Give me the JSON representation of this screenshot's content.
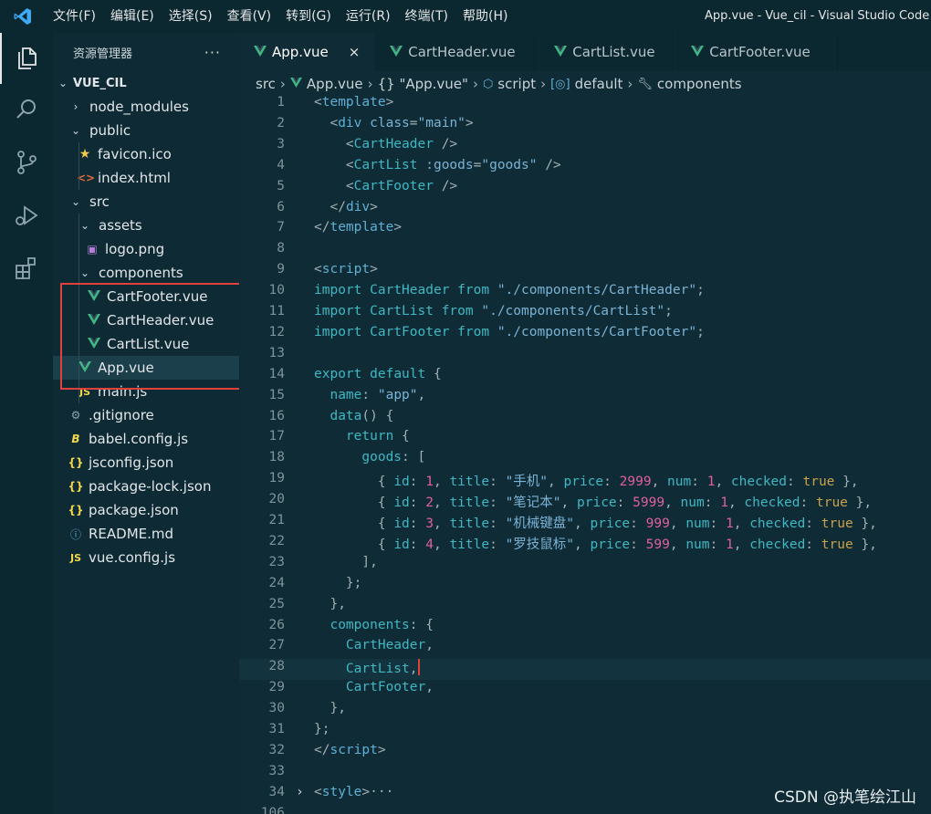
{
  "window": {
    "title": "App.vue - Vue_cil - Visual Studio Code",
    "menu": [
      "文件(F)",
      "编辑(E)",
      "选择(S)",
      "查看(V)",
      "转到(G)",
      "运行(R)",
      "终端(T)",
      "帮助(H)"
    ]
  },
  "activity": [
    "explorer-icon",
    "search-icon",
    "source-control-icon",
    "run-debug-icon",
    "extensions-icon"
  ],
  "sidebar": {
    "title": "资源管理器",
    "more": "···",
    "root": "VUE_CIL",
    "items": [
      {
        "label": "node_modules",
        "icon": "chevron-right",
        "depth": 1
      },
      {
        "label": "public",
        "icon": "chevron-down",
        "depth": 1
      },
      {
        "label": "favicon.ico",
        "icon": "star",
        "depth": 2
      },
      {
        "label": "index.html",
        "icon": "html",
        "depth": 2
      },
      {
        "label": "src",
        "icon": "chevron-down",
        "depth": 1
      },
      {
        "label": "assets",
        "icon": "chevron-down",
        "depth": 2
      },
      {
        "label": "logo.png",
        "icon": "image",
        "depth": 3
      },
      {
        "label": "components",
        "icon": "chevron-down",
        "depth": 2
      },
      {
        "label": "CartFooter.vue",
        "icon": "vue",
        "depth": 3
      },
      {
        "label": "CartHeader.vue",
        "icon": "vue",
        "depth": 3
      },
      {
        "label": "CartList.vue",
        "icon": "vue",
        "depth": 3
      },
      {
        "label": "App.vue",
        "icon": "vue",
        "depth": 2
      },
      {
        "label": "main.js",
        "icon": "js",
        "depth": 2
      },
      {
        "label": ".gitignore",
        "icon": "gear",
        "depth": 1
      },
      {
        "label": "babel.config.js",
        "icon": "babel",
        "depth": 1
      },
      {
        "label": "jsconfig.json",
        "icon": "json",
        "depth": 1
      },
      {
        "label": "package-lock.json",
        "icon": "json",
        "depth": 1
      },
      {
        "label": "package.json",
        "icon": "json",
        "depth": 1
      },
      {
        "label": "README.md",
        "icon": "info",
        "depth": 1
      },
      {
        "label": "vue.config.js",
        "icon": "js",
        "depth": 1
      }
    ]
  },
  "tabs": [
    {
      "label": "App.vue",
      "active": true,
      "close": "×"
    },
    {
      "label": "CartHeader.vue",
      "active": false
    },
    {
      "label": "CartList.vue",
      "active": false
    },
    {
      "label": "CartFooter.vue",
      "active": false
    }
  ],
  "breadcrumb": [
    "src",
    "App.vue",
    "{} \"App.vue\"",
    "script",
    "default",
    "components"
  ],
  "code": [
    {
      "n": "1",
      "html": "<span class='pm'>&lt;</span><span class='tg'>template</span><span class='pm'>&gt;</span>"
    },
    {
      "n": "2",
      "html": "  <span class='pm'>&lt;</span><span class='tg'>div</span> <span class='sr'>class</span><span class='pm'>=</span><span class='sr'>\"main\"</span><span class='pm'>&gt;</span>"
    },
    {
      "n": "3",
      "html": "    <span class='pm'>&lt;</span><span class='ky'>CartHeader</span> <span class='pm'>/&gt;</span>"
    },
    {
      "n": "4",
      "html": "    <span class='pm'>&lt;</span><span class='ky'>CartList</span> <span class='sr'>:goods</span><span class='pm'>=</span><span class='sr'>\"goods\"</span> <span class='pm'>/&gt;</span>"
    },
    {
      "n": "5",
      "html": "    <span class='pm'>&lt;</span><span class='ky'>CartFooter</span> <span class='pm'>/&gt;</span>"
    },
    {
      "n": "6",
      "html": "  <span class='pm'>&lt;/</span><span class='tg'>div</span><span class='pm'>&gt;</span>"
    },
    {
      "n": "7",
      "html": "<span class='pm'>&lt;/</span><span class='tg'>template</span><span class='pm'>&gt;</span>"
    },
    {
      "n": "8",
      "html": ""
    },
    {
      "n": "9",
      "html": "<span class='pm'>&lt;</span><span class='tg'>script</span><span class='pm'>&gt;</span>"
    },
    {
      "n": "10",
      "html": "<span class='ky'>import</span> <span class='ky'>CartHeader</span> <span class='ky'>from</span> <span class='sr'>\"./components/CartHeader\"</span><span class='pm'>;</span>"
    },
    {
      "n": "11",
      "html": "<span class='ky'>import</span> <span class='ky'>CartList</span> <span class='ky'>from</span> <span class='sr'>\"./components/CartList\"</span><span class='pm'>;</span>"
    },
    {
      "n": "12",
      "html": "<span class='ky'>import</span> <span class='ky'>CartFooter</span> <span class='ky'>from</span> <span class='sr'>\"./components/CartFooter\"</span><span class='pm'>;</span>"
    },
    {
      "n": "13",
      "html": ""
    },
    {
      "n": "14",
      "html": "<span class='ky'>export</span> <span class='ky'>default</span> <span class='pm'>{</span>"
    },
    {
      "n": "15",
      "html": "  <span class='ky'>name</span><span class='pm'>:</span> <span class='sr'>\"app\"</span><span class='pm'>,</span>"
    },
    {
      "n": "16",
      "html": "  <span class='ky'>data</span><span class='pm'>() {</span>"
    },
    {
      "n": "17",
      "html": "    <span class='ky'>return</span> <span class='pm'>{</span>"
    },
    {
      "n": "18",
      "html": "      <span class='ky'>goods</span><span class='pm'>: [</span>"
    },
    {
      "n": "19",
      "html": "        <span class='pm'>{</span> <span class='ky'>id</span><span class='pm'>:</span> <span class='pk'>1</span><span class='pm'>,</span> <span class='ky'>title</span><span class='pm'>:</span> <span class='sr'>\"手机\"</span><span class='pm'>,</span> <span class='ky'>price</span><span class='pm'>:</span> <span class='pk'>2999</span><span class='pm'>,</span> <span class='ky'>num</span><span class='pm'>:</span> <span class='pk'>1</span><span class='pm'>,</span> <span class='ky'>checked</span><span class='pm'>:</span> <span class='tr'>true</span> <span class='pm'>},</span>"
    },
    {
      "n": "20",
      "html": "        <span class='pm'>{</span> <span class='ky'>id</span><span class='pm'>:</span> <span class='pk'>2</span><span class='pm'>,</span> <span class='ky'>title</span><span class='pm'>:</span> <span class='sr'>\"笔记本\"</span><span class='pm'>,</span> <span class='ky'>price</span><span class='pm'>:</span> <span class='pk'>5999</span><span class='pm'>,</span> <span class='ky'>num</span><span class='pm'>:</span> <span class='pk'>1</span><span class='pm'>,</span> <span class='ky'>checked</span><span class='pm'>:</span> <span class='tr'>true</span> <span class='pm'>},</span>"
    },
    {
      "n": "21",
      "html": "        <span class='pm'>{</span> <span class='ky'>id</span><span class='pm'>:</span> <span class='pk'>3</span><span class='pm'>,</span> <span class='ky'>title</span><span class='pm'>:</span> <span class='sr'>\"机械键盘\"</span><span class='pm'>,</span> <span class='ky'>price</span><span class='pm'>:</span> <span class='pk'>999</span><span class='pm'>,</span> <span class='ky'>num</span><span class='pm'>:</span> <span class='pk'>1</span><span class='pm'>,</span> <span class='ky'>checked</span><span class='pm'>:</span> <span class='tr'>true</span> <span class='pm'>},</span>"
    },
    {
      "n": "22",
      "html": "        <span class='pm'>{</span> <span class='ky'>id</span><span class='pm'>:</span> <span class='pk'>4</span><span class='pm'>,</span> <span class='ky'>title</span><span class='pm'>:</span> <span class='sr'>\"罗技鼠标\"</span><span class='pm'>,</span> <span class='ky'>price</span><span class='pm'>:</span> <span class='pk'>599</span><span class='pm'>,</span> <span class='ky'>num</span><span class='pm'>:</span> <span class='pk'>1</span><span class='pm'>,</span> <span class='ky'>checked</span><span class='pm'>:</span> <span class='tr'>true</span> <span class='pm'>},</span>"
    },
    {
      "n": "23",
      "html": "      <span class='pm'>],</span>"
    },
    {
      "n": "24",
      "html": "    <span class='pm'>};</span>"
    },
    {
      "n": "25",
      "html": "  <span class='pm'>},</span>"
    },
    {
      "n": "26",
      "html": "  <span class='ky'>components</span><span class='pm'>: {</span>"
    },
    {
      "n": "27",
      "html": "    <span class='ky'>CartHeader</span><span class='pm'>,</span>"
    },
    {
      "n": "28",
      "html": "    <span class='ky'>CartList</span><span class='pm'>,</span><span class='caret'></span>"
    },
    {
      "n": "29",
      "html": "    <span class='ky'>CartFooter</span><span class='pm'>,</span>"
    },
    {
      "n": "30",
      "html": "  <span class='pm'>},</span>"
    },
    {
      "n": "31",
      "html": "<span class='pm'>};</span>"
    },
    {
      "n": "32",
      "html": "<span class='pm'>&lt;/</span><span class='tg'>script</span><span class='pm'>&gt;</span>"
    },
    {
      "n": "33",
      "html": ""
    },
    {
      "n": "34",
      "html": "<span class='pm'>&lt;</span><span class='tg'>style</span><span class='pm'>&gt;</span><span class='pm'>···</span>",
      "fold": "›"
    },
    {
      "n": "106",
      "html": ""
    }
  ],
  "watermark": "CSDN @执笔绘江山"
}
